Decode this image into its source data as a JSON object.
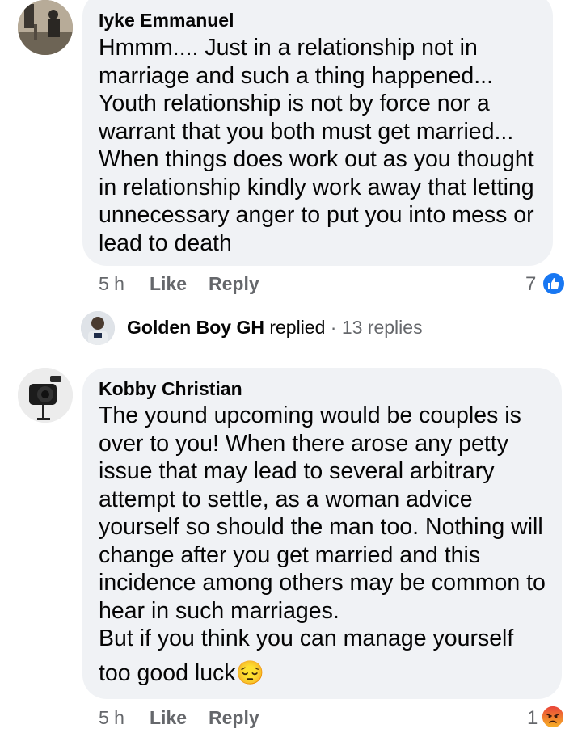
{
  "comments": [
    {
      "author": "Iyke Emmanuel",
      "lines": [
        "Hmmm.... Just in a relationship not in",
        "marriage and such a thing happened...",
        "Youth relationship is not by force nor a",
        "warrant that you both must get married...",
        "When things does work out as you thought",
        "in relationship kindly work away that letting",
        "unnecessary anger to put you into mess or",
        "lead to death"
      ],
      "time": "5 h",
      "like_label": "Like",
      "reply_label": "Reply",
      "reaction_count": "7",
      "reaction_icon": "like-icon",
      "reaction_color": "#1877f2"
    },
    {
      "author": "Kobby Christian",
      "lines": [
        "The yound upcoming would be couples is",
        "over to you! When there arose any petty",
        "issue that may lead to several arbitrary",
        "attempt to settle, as a woman advice",
        "yourself so should the man too. Nothing will",
        "change after you get married and this",
        "incidence among others may be common to",
        "hear in such marriages.",
        "But if you think you can manage yourself",
        "too good luck😔"
      ],
      "time": "5 h",
      "like_label": "Like",
      "reply_label": "Reply",
      "reaction_count": "1",
      "reaction_icon": "angry-icon",
      "reaction_color": "#f0542d"
    }
  ],
  "replies_summary": {
    "name": "Golden Boy GH",
    "verb": "replied",
    "separator": "·",
    "count_text": "13 replies"
  }
}
